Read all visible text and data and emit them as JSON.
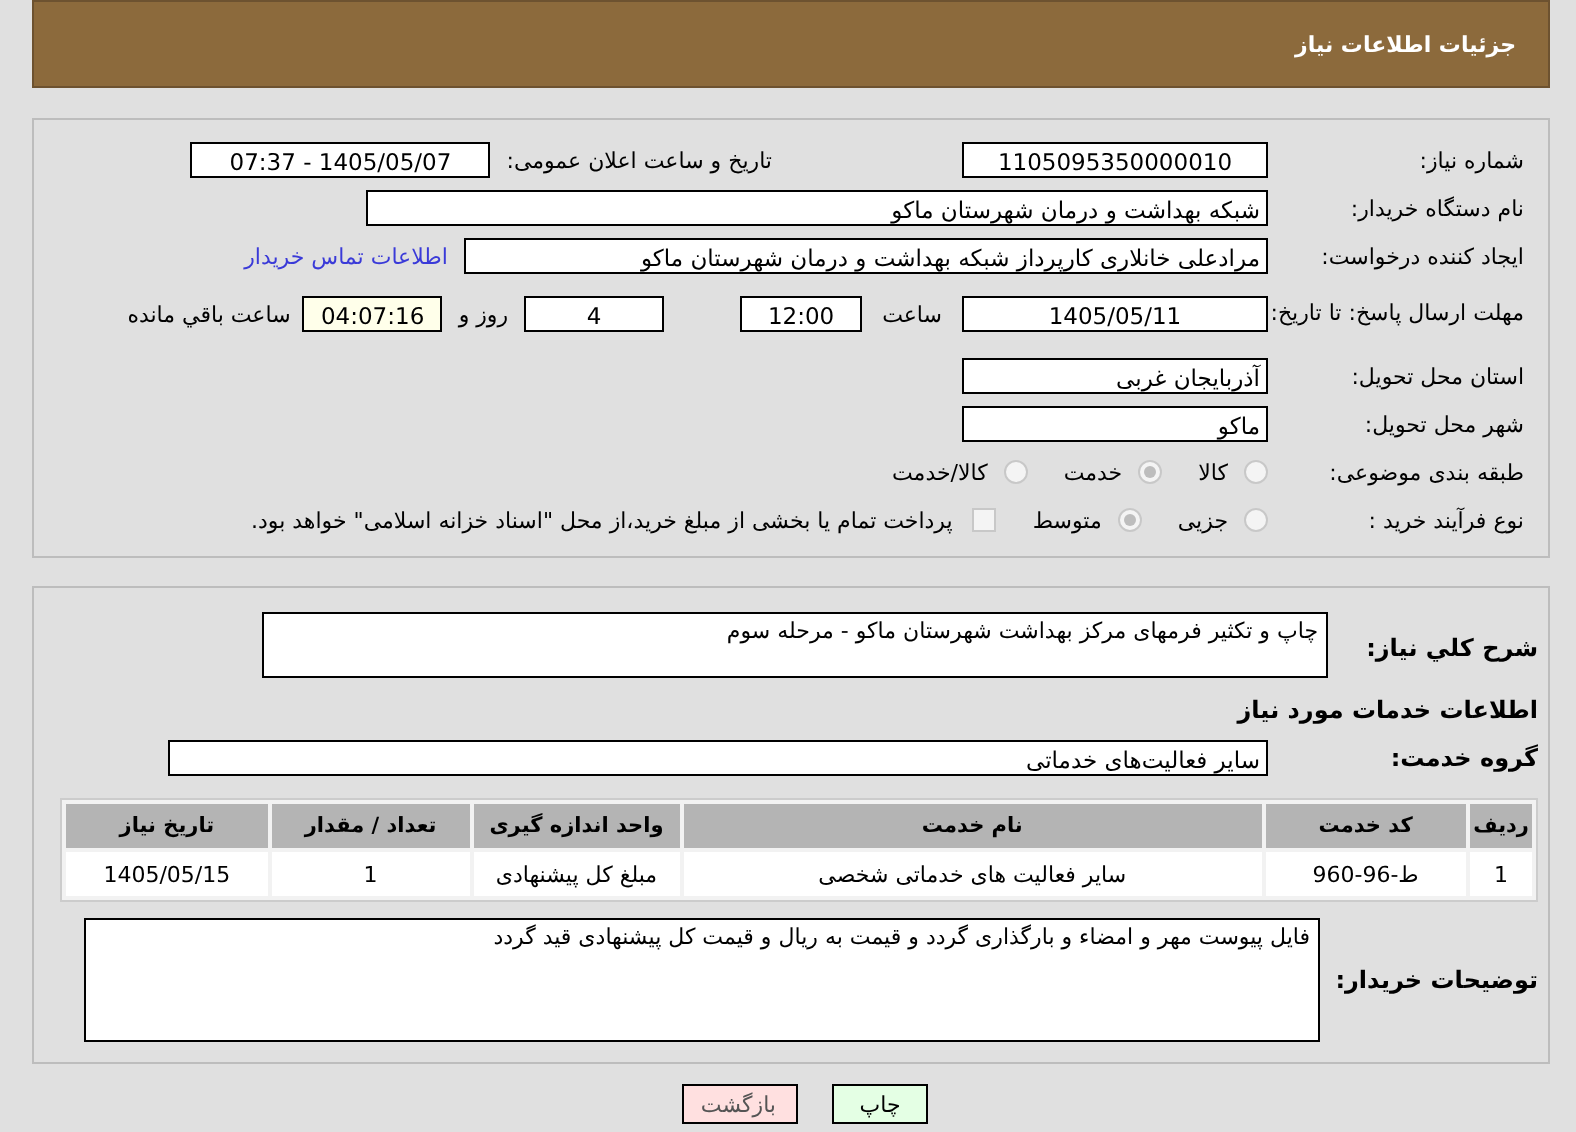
{
  "header": {
    "title": "جزئیات اطلاعات نیاز"
  },
  "need_number": {
    "label": "شماره نیاز:",
    "value": "1105095350000010"
  },
  "announce": {
    "label": "تاریخ و ساعت اعلان عمومی:",
    "value": "1405/05/07 - 07:37"
  },
  "buyer": {
    "label": "نام دستگاه خریدار:",
    "value": "شبکه بهداشت و درمان شهرستان ماکو"
  },
  "creator": {
    "label": "ایجاد کننده درخواست:",
    "value": "مرادعلی خانلاری کارپرداز شبکه بهداشت و درمان شهرستان ماکو",
    "link": "اطلاعات تماس خریدار"
  },
  "deadline": {
    "label": "مهلت ارسال پاسخ: تا تاریخ:",
    "date": "1405/05/11",
    "time_label": "ساعت",
    "time": "12:00",
    "days": "4",
    "days_label": "روز و",
    "remaining": "04:07:16",
    "remaining_label": "ساعت باقي مانده"
  },
  "province": {
    "label": "استان محل تحویل:",
    "value": "آذربایجان غربی"
  },
  "city": {
    "label": "شهر محل تحویل:",
    "value": "ماکو"
  },
  "category": {
    "label": "طبقه بندی موضوعی:",
    "options": [
      {
        "label": "کالا",
        "selected": false
      },
      {
        "label": "خدمت",
        "selected": true
      },
      {
        "label": "کالا/خدمت",
        "selected": false
      }
    ]
  },
  "purchase_type": {
    "label": "نوع فرآیند خرید :",
    "options": [
      {
        "label": "جزیی",
        "selected": false
      },
      {
        "label": "متوسط",
        "selected": true
      }
    ],
    "payment": {
      "checked": false,
      "label": "پرداخت تمام یا بخشی از مبلغ خرید،از محل \"اسناد خزانه اسلامی\" خواهد بود."
    }
  },
  "description": {
    "label": "شرح کلي نیاز:",
    "value": "چاپ و تکثیر فرمهای مرکز بهداشت شهرستان ماکو - مرحله سوم"
  },
  "services_heading": "اطلاعات خدمات مورد نیاز",
  "service_group": {
    "label": "گروه خدمت:",
    "value": "سایر فعالیت‌های خدماتی"
  },
  "table": {
    "columns": [
      "ردیف",
      "کد خدمت",
      "نام خدمت",
      "واحد اندازه گیری",
      "تعداد / مقدار",
      "تاریخ نیاز"
    ],
    "rows": [
      [
        "1",
        "ط-96-960",
        "سایر فعالیت های خدماتی شخصی",
        "مبلغ کل پیشنهادی",
        "1",
        "1405/05/15"
      ]
    ]
  },
  "buyer_notes": {
    "label": "توضیحات خریدار:",
    "value": "فایل پیوست مهر و امضاء و بارگذاری گردد و قیمت  به ریال و قیمت کل پیشنهادی قید گردد"
  },
  "buttons": [
    {
      "label": "چاپ",
      "kind": "print"
    },
    {
      "label": "بازگشت",
      "kind": "back"
    }
  ]
}
